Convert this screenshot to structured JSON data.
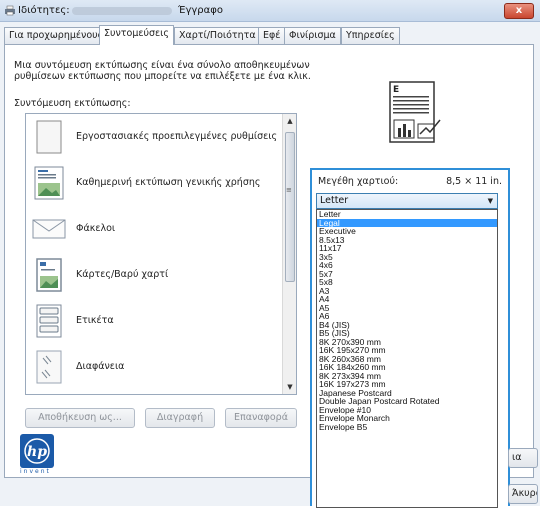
{
  "window": {
    "title": "Ιδιότητες:",
    "document": "Έγγραφο",
    "close_label": "x"
  },
  "tabs": [
    {
      "label": "Για προχωρημένους"
    },
    {
      "label": "Συντομεύσεις"
    },
    {
      "label": "Χαρτί/Ποιότητα"
    },
    {
      "label": "Εφέ"
    },
    {
      "label": "Φινίρισμα"
    },
    {
      "label": "Υπηρεσίες"
    }
  ],
  "shortcuts": {
    "description": "Μια συντόμευση εκτύπωσης είναι ένα σύνολο αποθηκευμένων ρυθμίσεων εκτύπωσης που μπορείτε να επιλέξετε με ένα κλικ.",
    "list_label": "Συντόμευση εκτύπωσης:",
    "items": [
      {
        "label": "Εργοστασιακές προεπιλεγμένες ρυθμίσεις",
        "icon": "blank-page-icon"
      },
      {
        "label": "Καθημερινή εκτύπωση γενικής χρήσης",
        "icon": "document-photo-icon"
      },
      {
        "label": "Φάκελοι",
        "icon": "envelope-icon"
      },
      {
        "label": "Κάρτες/Βαρύ χαρτί",
        "icon": "card-icon"
      },
      {
        "label": "Ετικέτα",
        "icon": "labels-icon"
      },
      {
        "label": "Διαφάνεια",
        "icon": "transparency-icon"
      }
    ]
  },
  "buttons": {
    "save_as": "Αποθήκευση ως...",
    "delete": "Διαγραφή",
    "reset": "Επαναφορά",
    "right_partial_1": "ια",
    "right_partial_2": "Άκυρο"
  },
  "branding": {
    "logo": "hp",
    "tagline": "invent",
    "color": "#1b5aa8"
  },
  "paper_sizes": {
    "label": "Μεγέθη χαρτιού:",
    "dimension": "8,5 × 11 in.",
    "selected": "Letter",
    "highlighted": "Legal",
    "options": [
      "Letter",
      "Legal",
      "Executive",
      "8.5x13",
      "11x17",
      "3x5",
      "4x6",
      "5x7",
      "5x8",
      "A3",
      "A4",
      "A5",
      "A6",
      "B4 (JIS)",
      "B5 (JIS)",
      "8K 270x390 mm",
      "16K 195x270 mm",
      "8K 260x368 mm",
      "16K 184x260 mm",
      "8K 273x394 mm",
      "16K 197x273 mm",
      "Japanese Postcard",
      "Double Japan Postcard Rotated",
      "Envelope #10",
      "Envelope Monarch",
      "Envelope B5"
    ]
  },
  "colors": {
    "accent": "#2f8fd8",
    "highlight": "#3399ff"
  }
}
